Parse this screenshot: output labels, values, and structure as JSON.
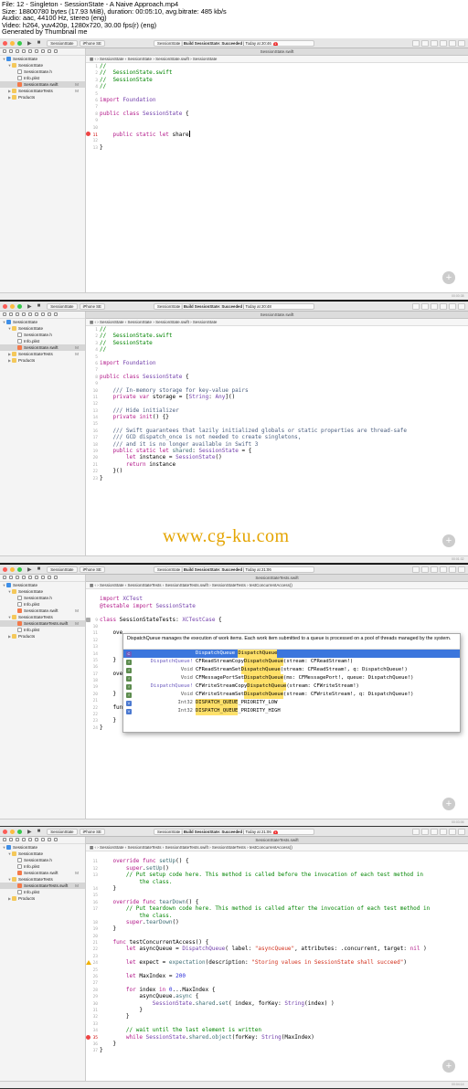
{
  "header": {
    "lines": [
      "File: 12 - Singleton - SessionState - A Naive Approach.mp4",
      "Size: 18800780 bytes (17.93 MiB), duration: 00:05:10, avg.bitrate: 485 kb/s",
      "Audio: aac, 44100 Hz, stereo (eng)",
      "Video: h264, yuv420p, 1280x720, 30.00 fps(r) (eng)",
      "Generated by Thumbnail me"
    ]
  },
  "watermark": "www.cg-ku.com",
  "colors": {
    "comment": "#008400",
    "keyword": "#b21889",
    "string": "#d12f1b",
    "type": "#703daa",
    "number": "#272ad8",
    "selection": "#3b76dd",
    "error": "#e44444",
    "warning": "#f0b000"
  },
  "frames": [
    {
      "scheme_app": "SessionState",
      "scheme_device": "iPhone SE",
      "activity_project": "SessionState",
      "activity_status": "Build SessionState: Succeeded",
      "activity_time": "Today at 20:46",
      "error_count": "1",
      "window_title": "SessionState.swift",
      "crumbs": [
        "SessionState",
        "SessionState",
        "SessionState.swift",
        "SessionState"
      ],
      "filter_placeholder": "Filter",
      "timestamp": "00:00:38",
      "nav": [
        {
          "label": "SessionState",
          "depth": 0,
          "icon": "proj",
          "tw": "▼",
          "status": ""
        },
        {
          "label": "SessionState",
          "depth": 1,
          "icon": "fold",
          "tw": "▼",
          "status": ""
        },
        {
          "label": "SessionState.h",
          "depth": 2,
          "icon": "file",
          "tw": "",
          "status": ""
        },
        {
          "label": "Info.plist",
          "depth": 2,
          "icon": "file",
          "tw": "",
          "status": ""
        },
        {
          "label": "SessionState.swift",
          "depth": 2,
          "icon": "swift",
          "tw": "",
          "status": "M",
          "sel": true
        },
        {
          "label": "SessionStateTests",
          "depth": 1,
          "icon": "fold",
          "tw": "▶",
          "status": "M"
        },
        {
          "label": "Products",
          "depth": 1,
          "icon": "fold",
          "tw": "▶",
          "status": ""
        }
      ],
      "lines": [
        {
          "n": "1",
          "t": "//",
          "k": "c"
        },
        {
          "n": "2",
          "t": "//  SessionState.swift",
          "k": "c"
        },
        {
          "n": "3",
          "t": "//  SessionState",
          "k": "c"
        },
        {
          "n": "4",
          "t": "//",
          "k": "c"
        },
        {
          "n": "5",
          "t": ""
        },
        {
          "n": "6",
          "t": "import Foundation"
        },
        {
          "n": "7",
          "t": ""
        },
        {
          "n": "8",
          "t": "public class SessionState {"
        },
        {
          "n": "9",
          "t": ""
        },
        {
          "n": "10",
          "t": ""
        },
        {
          "n": "11",
          "t": "    public static let share",
          "mark": "err",
          "cursor": true
        },
        {
          "n": "12",
          "t": ""
        },
        {
          "n": "13",
          "t": "}"
        }
      ]
    },
    {
      "scheme_app": "SessionState",
      "scheme_device": "iPhone SE",
      "activity_project": "SessionState",
      "activity_status": "Build SessionState: Succeeded",
      "activity_time": "Today at 20:48",
      "error_count": "",
      "window_title": "SessionState.swift",
      "crumbs": [
        "SessionState",
        "SessionState",
        "SessionState.swift",
        "SessionState"
      ],
      "filter_placeholder": "Filter",
      "timestamp": "00:01:32",
      "nav": [
        {
          "label": "SessionState",
          "depth": 0,
          "icon": "proj",
          "tw": "▼",
          "status": ""
        },
        {
          "label": "SessionState",
          "depth": 1,
          "icon": "fold",
          "tw": "▼",
          "status": ""
        },
        {
          "label": "SessionState.h",
          "depth": 2,
          "icon": "file",
          "tw": "",
          "status": ""
        },
        {
          "label": "Info.plist",
          "depth": 2,
          "icon": "file",
          "tw": "",
          "status": ""
        },
        {
          "label": "SessionState.swift",
          "depth": 2,
          "icon": "swift",
          "tw": "",
          "status": "M",
          "sel": true
        },
        {
          "label": "SessionStateTests",
          "depth": 1,
          "icon": "fold",
          "tw": "▶",
          "status": "M"
        },
        {
          "label": "Products",
          "depth": 1,
          "icon": "fold",
          "tw": "▶",
          "status": ""
        }
      ],
      "lines": [
        {
          "n": "1",
          "t": "//",
          "k": "c"
        },
        {
          "n": "2",
          "t": "//  SessionState.swift",
          "k": "c"
        },
        {
          "n": "3",
          "t": "//  SessionState",
          "k": "c"
        },
        {
          "n": "4",
          "t": "//",
          "k": "c"
        },
        {
          "n": "5",
          "t": ""
        },
        {
          "n": "6",
          "t": "import Foundation"
        },
        {
          "n": "7",
          "t": ""
        },
        {
          "n": "8",
          "t": "public class SessionState {"
        },
        {
          "n": "9",
          "t": ""
        },
        {
          "n": "10",
          "t": "    /// In-memory storage for key-value pairs",
          "k": "d"
        },
        {
          "n": "11",
          "t": "    private var storage = [String: Any]()"
        },
        {
          "n": "12",
          "t": ""
        },
        {
          "n": "13",
          "t": "    /// Hide initializer",
          "k": "d"
        },
        {
          "n": "14",
          "t": "    private init() {}"
        },
        {
          "n": "15",
          "t": ""
        },
        {
          "n": "16",
          "t": "    /// Swift guarantees that lazily initialized globals or static properties are thread-safe",
          "k": "d"
        },
        {
          "n": "17",
          "t": "    /// GCD dispatch_once is not needed to create singletons,",
          "k": "d"
        },
        {
          "n": "18",
          "t": "    /// and it is no longer available in Swift 3",
          "k": "d"
        },
        {
          "n": "19",
          "t": "    public static let shared: SessionState = {"
        },
        {
          "n": "20",
          "t": "        let instance = SessionState()"
        },
        {
          "n": "21",
          "t": "        return instance"
        },
        {
          "n": "22",
          "t": "    }()"
        },
        {
          "n": "23",
          "t": "}"
        }
      ]
    },
    {
      "scheme_app": "SessionState",
      "scheme_device": "iPhone SE",
      "activity_project": "SessionState",
      "activity_status": "Build SessionState: Succeeded",
      "activity_time": "Today at 21:06",
      "error_count": "",
      "window_title": "SessionStateTests.swift",
      "crumbs": [
        "SessionState",
        "SessionStateTests",
        "SessionStateTests.swift",
        "SessionStateTests",
        "testConcurrentAccess()"
      ],
      "filter_placeholder": "Filter",
      "timestamp": "00:03:06",
      "nav": [
        {
          "label": "SessionState",
          "depth": 0,
          "icon": "proj",
          "tw": "▼",
          "status": ""
        },
        {
          "label": "SessionState",
          "depth": 1,
          "icon": "fold",
          "tw": "▼",
          "status": ""
        },
        {
          "label": "SessionState.h",
          "depth": 2,
          "icon": "file",
          "tw": "",
          "status": ""
        },
        {
          "label": "Info.plist",
          "depth": 2,
          "icon": "file",
          "tw": "",
          "status": ""
        },
        {
          "label": "SessionState.swift",
          "depth": 2,
          "icon": "swift",
          "tw": "",
          "status": "M"
        },
        {
          "label": "SessionStateTests",
          "depth": 1,
          "icon": "fold",
          "tw": "▼",
          "status": ""
        },
        {
          "label": "SessionStateTests.swift",
          "depth": 2,
          "icon": "swift",
          "tw": "",
          "status": "M",
          "sel": true
        },
        {
          "label": "Info.plist",
          "depth": 2,
          "icon": "file",
          "tw": "",
          "status": ""
        },
        {
          "label": "Products",
          "depth": 1,
          "icon": "fold",
          "tw": "▶",
          "status": ""
        }
      ],
      "lines": [
        {
          "n": "",
          "t": ""
        },
        {
          "n": "",
          "t": "import XCTest"
        },
        {
          "n": "",
          "t": "@testable import SessionState"
        },
        {
          "n": "",
          "t": ""
        },
        {
          "n": "9",
          "t": "class SessionStateTests: XCTestCase {",
          "mark": "gear"
        },
        {
          "n": "10",
          "t": ""
        },
        {
          "n": "11",
          "t": "    ove"
        },
        {
          "n": "12",
          "t": ""
        },
        {
          "n": "13",
          "t": ""
        },
        {
          "n": "14",
          "t": ""
        },
        {
          "n": "15",
          "t": "    }"
        },
        {
          "n": "16",
          "t": ""
        },
        {
          "n": "17",
          "t": "    ove"
        },
        {
          "n": "18",
          "t": ""
        },
        {
          "n": "19",
          "t": ""
        },
        {
          "n": "20",
          "t": "    }"
        },
        {
          "n": "21",
          "t": ""
        },
        {
          "n": "22",
          "t": "    fun"
        },
        {
          "n": "22",
          "t": "        let asyncQueue = DispatchQueue"
        },
        {
          "n": "23",
          "t": "    }"
        },
        {
          "n": "24",
          "t": "}"
        }
      ],
      "autocomplete": {
        "doc": "DispatchQueue manages the execution of work items. Each work item submitted to a queue is processed on a pool of threads managed by the system.",
        "items": [
          {
            "kind": "C",
            "ret": "",
            "prefix": "DispatchQueue ",
            "match": "DispatchQueue",
            "rest": "",
            "sel": true
          },
          {
            "kind": "f",
            "ret": "DispatchQueue!",
            "prefix": "CFReadStreamCopy",
            "match": "DispatchQueue",
            "rest": "(stream: CFReadStream!)"
          },
          {
            "kind": "f",
            "ret": "Void",
            "prefix": "CFReadStreamSet",
            "match": "DispatchQueue",
            "rest": "(stream: CFReadStream!, q: DispatchQueue!)"
          },
          {
            "kind": "f",
            "ret": "Void",
            "prefix": "CFMessagePortSet",
            "match": "DispatchQueue",
            "rest": "(ms: CFMessagePort!, queue: DispatchQueue!)"
          },
          {
            "kind": "f",
            "ret": "DispatchQueue!",
            "prefix": "CFWriteStreamCopy",
            "match": "DispatchQueue",
            "rest": "(stream: CFWriteStream!)"
          },
          {
            "kind": "f",
            "ret": "Void",
            "prefix": "CFWriteStreamSet",
            "match": "DispatchQueue",
            "rest": "(stream: CFWriteStream!, q: DispatchQueue!)"
          },
          {
            "kind": "V",
            "ret": "Int32",
            "prefix": "",
            "match": "DISPATCH_QUEUE",
            "rest": "_PRIORITY_LOW"
          },
          {
            "kind": "V",
            "ret": "Int32",
            "prefix": "",
            "match": "DISPATCH_QUEUE",
            "rest": "_PRIORITY_HIGH"
          }
        ]
      }
    },
    {
      "scheme_app": "SessionState",
      "scheme_device": "iPhone SE",
      "activity_project": "SessionState",
      "activity_status": "Build SessionState: Succeeded",
      "activity_time": "Today at 21:06",
      "error_count": "1",
      "window_title": "SessionStateTests.swift",
      "crumbs": [
        "SessionState",
        "SessionStateTests",
        "SessionStateTests.swift",
        "SessionStateTests",
        "testConcurrentAccess()"
      ],
      "filter_placeholder": "Filter",
      "timestamp": "00:04:14",
      "nav": [
        {
          "label": "SessionState",
          "depth": 0,
          "icon": "proj",
          "tw": "▼",
          "status": ""
        },
        {
          "label": "SessionState",
          "depth": 1,
          "icon": "fold",
          "tw": "▼",
          "status": ""
        },
        {
          "label": "SessionState.h",
          "depth": 2,
          "icon": "file",
          "tw": "",
          "status": ""
        },
        {
          "label": "Info.plist",
          "depth": 2,
          "icon": "file",
          "tw": "",
          "status": ""
        },
        {
          "label": "SessionState.swift",
          "depth": 2,
          "icon": "swift",
          "tw": "",
          "status": "M"
        },
        {
          "label": "SessionStateTests",
          "depth": 1,
          "icon": "fold",
          "tw": "▼",
          "status": ""
        },
        {
          "label": "SessionStateTests.swift",
          "depth": 2,
          "icon": "swift",
          "tw": "",
          "status": "M",
          "sel": true
        },
        {
          "label": "Info.plist",
          "depth": 2,
          "icon": "file",
          "tw": "",
          "status": ""
        },
        {
          "label": "Products",
          "depth": 1,
          "icon": "fold",
          "tw": "▶",
          "status": ""
        }
      ],
      "lines": [
        {
          "n": "",
          "t": ""
        },
        {
          "n": "11",
          "t": "    override func setUp() {"
        },
        {
          "n": "12",
          "t": "        super.setUp()"
        },
        {
          "n": "13",
          "t": "        // Put setup code here. This method is called before the invocation of each test method in",
          "k": "c"
        },
        {
          "n": "",
          "t": "            the class.",
          "k": "c"
        },
        {
          "n": "14",
          "t": "    }"
        },
        {
          "n": "15",
          "t": ""
        },
        {
          "n": "16",
          "t": "    override func tearDown() {"
        },
        {
          "n": "17",
          "t": "        // Put teardown code here. This method is called after the invocation of each test method in",
          "k": "c"
        },
        {
          "n": "",
          "t": "            the class.",
          "k": "c"
        },
        {
          "n": "18",
          "t": "        super.tearDown()"
        },
        {
          "n": "19",
          "t": "    }"
        },
        {
          "n": "20",
          "t": ""
        },
        {
          "n": "21",
          "t": "    func testConcurrentAccess() {"
        },
        {
          "n": "22",
          "t": "        let asyncQueue = DispatchQueue( label: \"asyncQueue\", attributes: .concurrent, target: nil )"
        },
        {
          "n": "23",
          "t": ""
        },
        {
          "n": "24",
          "t": "        let expect = expectation(description: \"Storing values in SessionState shall succeed\")",
          "mark": "warn"
        },
        {
          "n": "25",
          "t": ""
        },
        {
          "n": "26",
          "t": "        let MaxIndex = 200"
        },
        {
          "n": "27",
          "t": ""
        },
        {
          "n": "28",
          "t": "        for index in 0...MaxIndex {"
        },
        {
          "n": "29",
          "t": "            asyncQueue.async {"
        },
        {
          "n": "30",
          "t": "                SessionState.shared.set( index, forKey: String(index) )"
        },
        {
          "n": "31",
          "t": "            }"
        },
        {
          "n": "32",
          "t": "        }"
        },
        {
          "n": "33",
          "t": ""
        },
        {
          "n": "34",
          "t": "        // wait until the last element is written",
          "k": "c"
        },
        {
          "n": "35",
          "t": "        while SessionState.shared.object(forKey: String(MaxIndex)",
          "mark": "err"
        },
        {
          "n": "36",
          "t": "    }"
        },
        {
          "n": "37",
          "t": "}"
        }
      ]
    }
  ]
}
